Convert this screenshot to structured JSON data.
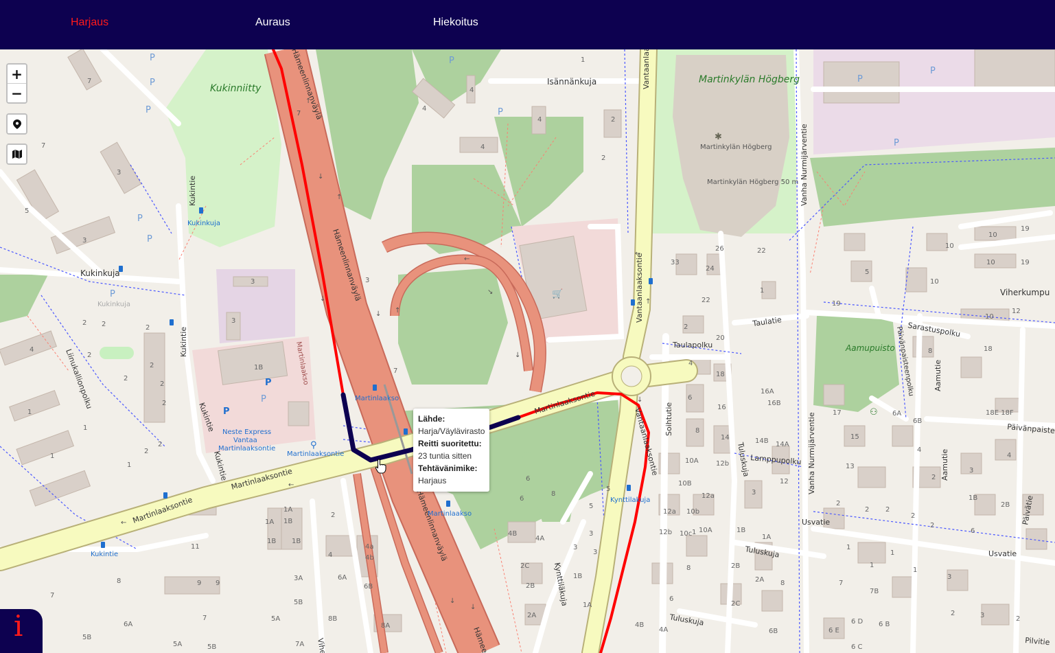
{
  "nav": {
    "items": [
      {
        "label": "Harjaus",
        "active": true
      },
      {
        "label": "Auraus",
        "active": false
      },
      {
        "label": "Hiekoitus",
        "active": false
      }
    ],
    "active_color": "#ff1a1a",
    "background_color": "#0d0150"
  },
  "map_controls": {
    "zoom_in": "+",
    "zoom_out": "−",
    "locate_icon": "location-pin-icon",
    "layers_icon": "map-layers-icon"
  },
  "popup": {
    "source_label": "Lähde:",
    "source_value": "Harja/Väylävirasto",
    "completed_label": "Reitti suoritettu:",
    "completed_value": "23 tuntia sitten",
    "task_label": "Tehtävänimike:",
    "task_value": "Harjaus"
  },
  "route_colors": {
    "recent": "#ff0000",
    "selected": "#0d0150"
  },
  "info_button": {
    "label": "i"
  },
  "map_labels": {
    "kukinniitty": "Kukinniitty",
    "martinkylan_hogberg": "Martinkylän Högberg",
    "martinkylan_hogberg_small": "Martinkylän Högberg",
    "martinkylan_hogberg_peak": "Martinkylän Högberg 50 m",
    "isannankuja": "Isännänkuja",
    "vantaanlaakso_top": "Vantaanlaakso",
    "hameenlinnanvayla_top": "Hämeenlinnanväylä",
    "hameenlinnanvayla_mid": "Hämeenlinnanväylä",
    "hameenlinnanvayla_low": "Hämeenlinnanväylä",
    "hameenlinnanvayla_bottom": "Hämee",
    "kukinkuja_stop": "Kukinkuja",
    "kukinkuja_road": "Kukinkuja",
    "kukinkuja_gray": "Kukinkuja",
    "kukintie_a": "Kukintie",
    "kukintie_b": "Kukintie",
    "kukintie_c": "Kukintie",
    "kukintie_d": "Kukintie",
    "kukintie_stop": "Kukintie",
    "liinukallionpolku": "Liinukallionpolku",
    "martinlaakso_vertical": "Martinlaakso",
    "neste": "Neste Express Vantaa Martinlaaksontie",
    "martinlaakso_station": "Martinlaakso",
    "martinlaakso_station2": "Martinlaakso",
    "martinlaaksontie_bike": "Martinlaaksontie",
    "martinlaaksontie_a": "Martinlaaksontie",
    "martinlaaksontie_b": "Martinlaaksontie",
    "martinlaaksontie_c": "Martinlaaksontie",
    "vantaanlaaksontie": "Vantaanlaaksontie",
    "vantaanlaaksontie_lower": "Vantaanlaaksontie",
    "soihtutie": "Soihtutie",
    "taulatie": "Taulatie",
    "taulapolku": "Taulapolku",
    "vanha_nurmijarventie_a": "Vanha Nurmijärventie",
    "vanha_nurmijarventie_b": "Vanha Nurmijärventie",
    "tuluskuja_a": "Tuluskuja",
    "tuluskuja_b": "Tuluskuja",
    "tuluskuja_c": "Tuluskuja",
    "lamppupolku": "Lamppupolku",
    "kynttilakuja": "Kynttiläkuja",
    "kynttilakuja_stop": "Kynttilakuja",
    "usvatie_a": "Usvatie",
    "usvatie_b": "Usvatie",
    "aamupuisto": "Aamupuisto",
    "viherkumpu": "Viherkumpu",
    "sarastuspolku": "Sarastuspolku",
    "paivanpaisteenpolku": "Päivänpaisteenpolku",
    "aamutie_a": "Aamutie",
    "aamutie_b": "Aamutie",
    "paivatie": "Päivätie",
    "paivanpaiste": "Päivänpaiste",
    "pilvitie": "Pilvitie",
    "vihe": "Vihe"
  }
}
